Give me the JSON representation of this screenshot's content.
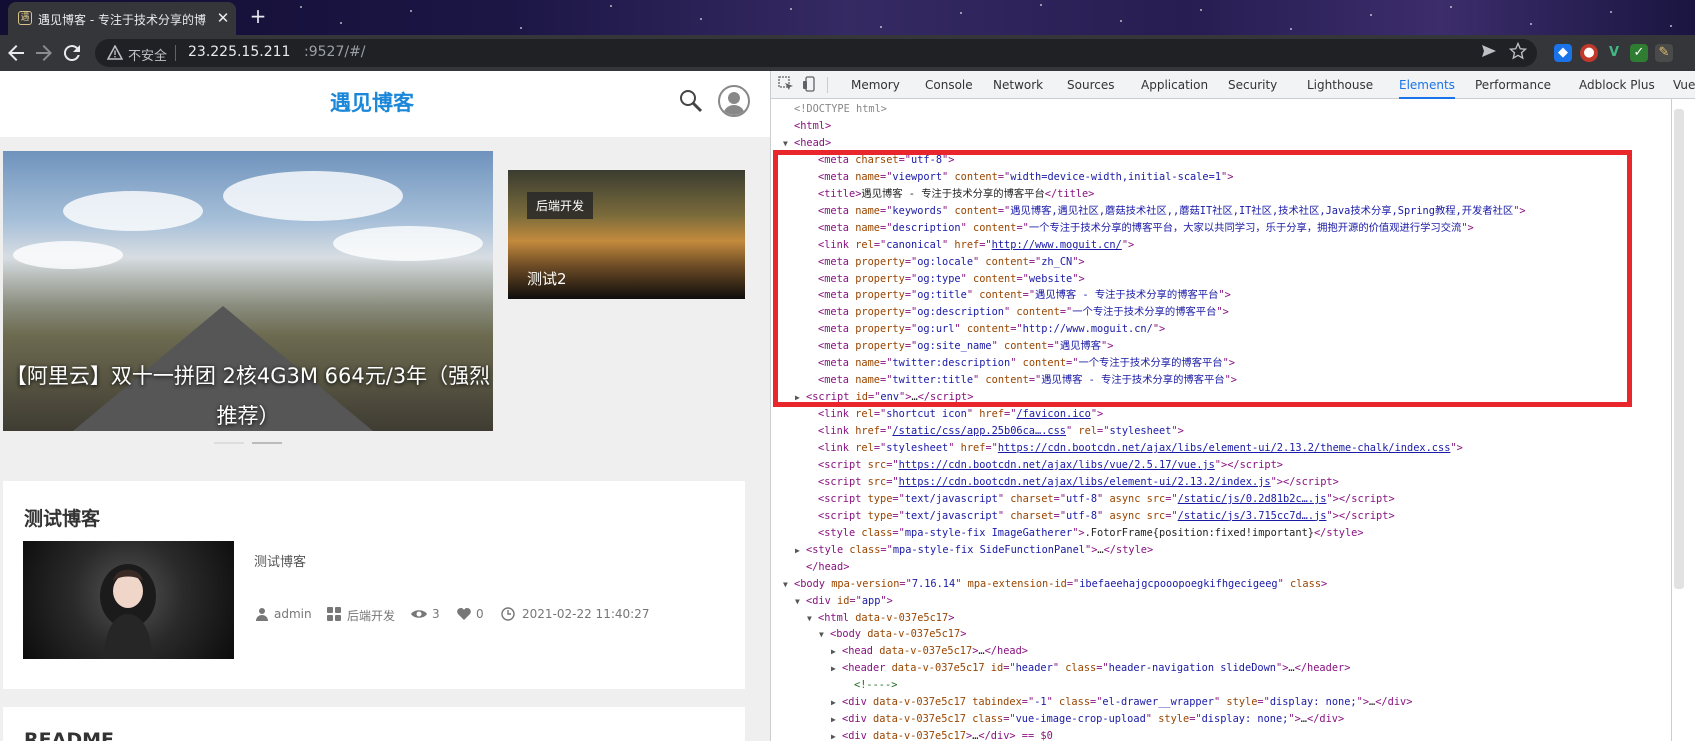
{
  "browser": {
    "tab_title": "遇见博客 - 专注于技术分享的博客平台",
    "tab_favicon": "遇",
    "close_glyph": "✕",
    "new_tab_glyph": "+",
    "security_label": "不安全",
    "url_host": "23.225.15.211",
    "url_path": ":9527/#/",
    "icons": {
      "back": "back-arrow-icon",
      "forward": "forward-arrow-icon",
      "reload": "reload-icon",
      "warning": "warning-icon",
      "send": "send-icon",
      "star": "bookmark-star-icon"
    },
    "extensions": [
      "ext-blue-icon",
      "ext-owl-icon",
      "ext-vue-icon",
      "ext-green-icon",
      "ext-puzzle-icon"
    ]
  },
  "site": {
    "name": "遇见博客",
    "hero_caption": "【阿里云】双十一拼团 2核4G3M 664元/3年（强烈推荐）",
    "side_tag": "后端开发",
    "side_title": "测试2",
    "card": {
      "title": "测试博客",
      "summary": "测试博客",
      "author": "admin",
      "category": "后端开发",
      "views": "3",
      "likes": "0",
      "date": "2021-02-22 11:40:27"
    },
    "card2_title": "README"
  },
  "devtools": {
    "tabs": [
      "Memory",
      "Console",
      "Network",
      "Sources",
      "Application",
      "Security",
      "Lighthouse",
      "Elements",
      "Performance",
      "Adblock Plus",
      "Vue"
    ],
    "active_tab": "Elements",
    "lines": [
      {
        "i": 0,
        "arrow": "",
        "html": "<span class=gy>&lt;!DOCTYPE html&gt;</span>"
      },
      {
        "i": 0,
        "arrow": "",
        "html": "<span class=tg>&lt;html&gt;</span>"
      },
      {
        "i": 0,
        "arrow": "▼",
        "html": "<span class=tg>&lt;head&gt;</span>"
      },
      {
        "i": 2,
        "arrow": "",
        "html": "<span class=tg>&lt;meta </span><span class=an>charset</span><span class=tg>=\"</span><span class=av>utf-8</span><span class=tg>\"&gt;</span>"
      },
      {
        "i": 2,
        "arrow": "",
        "html": "<span class=tg>&lt;meta </span><span class=an>name</span><span class=tg>=\"</span><span class=av>viewport</span><span class=tg>\" </span><span class=an>content</span><span class=tg>=\"</span><span class=av>width=device-width,initial-scale=1</span><span class=tg>\"&gt;</span>"
      },
      {
        "i": 2,
        "arrow": "",
        "html": "<span class=tg>&lt;title&gt;</span><span class=tx>遇见博客 - 专注于技术分享的博客平台</span><span class=tg>&lt;/title&gt;</span>"
      },
      {
        "i": 2,
        "arrow": "",
        "html": "<span class=tg>&lt;meta </span><span class=an>name</span><span class=tg>=\"</span><span class=av>keywords</span><span class=tg>\" </span><span class=an>content</span><span class=tg>=\"</span><span class=av>遇见博客,遇见社区,蘑菇技术社区,,蘑菇IT社区,IT社区,技术社区,Java技术分享,Spring教程,开发者社区</span><span class=tg>\"&gt;</span>"
      },
      {
        "i": 2,
        "arrow": "",
        "html": "<span class=tg>&lt;meta </span><span class=an>name</span><span class=tg>=\"</span><span class=av>description</span><span class=tg>\" </span><span class=an>content</span><span class=tg>=\"</span><span class=av>一个专注于技术分享的博客平台，大家以共同学习，乐于分享，拥抱开源的价值观进行学习交流</span><span class=tg>\"&gt;</span>"
      },
      {
        "i": 2,
        "arrow": "",
        "html": "<span class=tg>&lt;link </span><span class=an>rel</span><span class=tg>=\"</span><span class=av>canonical</span><span class=tg>\" </span><span class=an>href</span><span class=tg>=\"</span><span class=lk>http://www.moguit.cn/</span><span class=tg>\"&gt;</span>"
      },
      {
        "i": 2,
        "arrow": "",
        "html": "<span class=tg>&lt;meta </span><span class=an>property</span><span class=tg>=\"</span><span class=av>og:locale</span><span class=tg>\" </span><span class=an>content</span><span class=tg>=\"</span><span class=av>zh_CN</span><span class=tg>\"&gt;</span>"
      },
      {
        "i": 2,
        "arrow": "",
        "html": "<span class=tg>&lt;meta </span><span class=an>property</span><span class=tg>=\"</span><span class=av>og:type</span><span class=tg>\" </span><span class=an>content</span><span class=tg>=\"</span><span class=av>website</span><span class=tg>\"&gt;</span>"
      },
      {
        "i": 2,
        "arrow": "",
        "html": "<span class=tg>&lt;meta </span><span class=an>property</span><span class=tg>=\"</span><span class=av>og:title</span><span class=tg>\" </span><span class=an>content</span><span class=tg>=\"</span><span class=av>遇见博客 - 专注于技术分享的博客平台</span><span class=tg>\"&gt;</span>"
      },
      {
        "i": 2,
        "arrow": "",
        "html": "<span class=tg>&lt;meta </span><span class=an>property</span><span class=tg>=\"</span><span class=av>og:description</span><span class=tg>\" </span><span class=an>content</span><span class=tg>=\"</span><span class=av>一个专注于技术分享的博客平台</span><span class=tg>\"&gt;</span>"
      },
      {
        "i": 2,
        "arrow": "",
        "html": "<span class=tg>&lt;meta </span><span class=an>property</span><span class=tg>=\"</span><span class=av>og:url</span><span class=tg>\" </span><span class=an>content</span><span class=tg>=\"</span><span class=av>http://www.moguit.cn/</span><span class=tg>\"&gt;</span>"
      },
      {
        "i": 2,
        "arrow": "",
        "html": "<span class=tg>&lt;meta </span><span class=an>property</span><span class=tg>=\"</span><span class=av>og:site_name</span><span class=tg>\" </span><span class=an>content</span><span class=tg>=\"</span><span class=av>遇见博客</span><span class=tg>\"&gt;</span>"
      },
      {
        "i": 2,
        "arrow": "",
        "html": "<span class=tg>&lt;meta </span><span class=an>name</span><span class=tg>=\"</span><span class=av>twitter:description</span><span class=tg>\" </span><span class=an>content</span><span class=tg>=\"</span><span class=av>一个专注于技术分享的博客平台</span><span class=tg>\"&gt;</span>"
      },
      {
        "i": 2,
        "arrow": "",
        "html": "<span class=tg>&lt;meta </span><span class=an>name</span><span class=tg>=\"</span><span class=av>twitter:title</span><span class=tg>\" </span><span class=an>content</span><span class=tg>=\"</span><span class=av>遇见博客 - 专注于技术分享的博客平台</span><span class=tg>\"&gt;</span>"
      },
      {
        "i": 1,
        "arrow": "▶",
        "html": "<span class=tg>&lt;script </span><span class=an>id</span><span class=tg>=\"</span><span class=av>env</span><span class=tg>\"&gt;</span><span class=tx>…</span><span class=tg>&lt;/script&gt;</span>"
      },
      {
        "i": 2,
        "arrow": "",
        "html": "<span class=tg>&lt;link </span><span class=an>rel</span><span class=tg>=\"</span><span class=av>shortcut icon</span><span class=tg>\" </span><span class=an>href</span><span class=tg>=\"</span><span class=lk>/favicon.ico</span><span class=tg>\"&gt;</span>"
      },
      {
        "i": 2,
        "arrow": "",
        "html": "<span class=tg>&lt;link </span><span class=an>href</span><span class=tg>=\"</span><span class=lk>/static/css/app.25b06ca….css</span><span class=tg>\" </span><span class=an>rel</span><span class=tg>=\"</span><span class=av>stylesheet</span><span class=tg>\"&gt;</span>"
      },
      {
        "i": 2,
        "arrow": "",
        "html": "<span class=tg>&lt;link </span><span class=an>rel</span><span class=tg>=\"</span><span class=av>stylesheet</span><span class=tg>\" </span><span class=an>href</span><span class=tg>=\"</span><span class=lk>https://cdn.bootcdn.net/ajax/libs/element-ui/2.13.2/theme-chalk/index.css</span><span class=tg>\"&gt;</span>"
      },
      {
        "i": 2,
        "arrow": "",
        "html": "<span class=tg>&lt;script </span><span class=an>src</span><span class=tg>=\"</span><span class=lk>https://cdn.bootcdn.net/ajax/libs/vue/2.5.17/vue.js</span><span class=tg>\"&gt;&lt;/script&gt;</span>"
      },
      {
        "i": 2,
        "arrow": "",
        "html": "<span class=tg>&lt;script </span><span class=an>src</span><span class=tg>=\"</span><span class=lk>https://cdn.bootcdn.net/ajax/libs/element-ui/2.13.2/index.js</span><span class=tg>\"&gt;&lt;/script&gt;</span>"
      },
      {
        "i": 2,
        "arrow": "",
        "html": "<span class=tg>&lt;script </span><span class=an>type</span><span class=tg>=\"</span><span class=av>text/javascript</span><span class=tg>\" </span><span class=an>charset</span><span class=tg>=\"</span><span class=av>utf-8</span><span class=tg>\" </span><span class=an>async src</span><span class=tg>=\"</span><span class=lk>/static/js/0.2d81b2c….js</span><span class=tg>\"&gt;&lt;/script&gt;</span>"
      },
      {
        "i": 2,
        "arrow": "",
        "html": "<span class=tg>&lt;script </span><span class=an>type</span><span class=tg>=\"</span><span class=av>text/javascript</span><span class=tg>\" </span><span class=an>charset</span><span class=tg>=\"</span><span class=av>utf-8</span><span class=tg>\" </span><span class=an>async src</span><span class=tg>=\"</span><span class=lk>/static/js/3.715cc7d….js</span><span class=tg>\"&gt;&lt;/script&gt;</span>"
      },
      {
        "i": 2,
        "arrow": "",
        "html": "<span class=tg>&lt;style </span><span class=an>class</span><span class=tg>=\"</span><span class=av>mpa-style-fix ImageGatherer</span><span class=tg>\"&gt;</span><span class=tx>.FotorFrame{position:fixed!important}</span><span class=tg>&lt;/style&gt;</span>"
      },
      {
        "i": 1,
        "arrow": "▶",
        "html": "<span class=tg>&lt;style </span><span class=an>class</span><span class=tg>=\"</span><span class=av>mpa-style-fix SideFunctionPanel</span><span class=tg>\"&gt;</span><span class=tx>…</span><span class=tg>&lt;/style&gt;</span>"
      },
      {
        "i": 1,
        "arrow": "",
        "html": "<span class=tg>&lt;/head&gt;</span>"
      },
      {
        "i": 0,
        "arrow": "▼",
        "html": "<span class=tg>&lt;body </span><span class=an>mpa-version</span><span class=tg>=\"</span><span class=av>7.16.14</span><span class=tg>\" </span><span class=an>mpa-extension-id</span><span class=tg>=\"</span><span class=av>ibefaeehajgcpooopoegkifhgecigeeg</span><span class=tg>\" </span><span class=an>class</span><span class=tg>&gt;</span>"
      },
      {
        "i": 1,
        "arrow": "▼",
        "html": "<span class=tg>&lt;div </span><span class=an>id</span><span class=tg>=\"</span><span class=av>app</span><span class=tg>\"&gt;</span>"
      },
      {
        "i": 2,
        "arrow": "▼",
        "html": "<span class=tg>&lt;html </span><span class=an>data-v-037e5c17</span><span class=tg>&gt;</span>"
      },
      {
        "i": 3,
        "arrow": "▼",
        "html": "<span class=tg>&lt;body </span><span class=an>data-v-037e5c17</span><span class=tg>&gt;</span>"
      },
      {
        "i": 4,
        "arrow": "▶",
        "html": "<span class=tg>&lt;head </span><span class=an>data-v-037e5c17</span><span class=tg>&gt;</span><span class=tx>…</span><span class=tg>&lt;/head&gt;</span>"
      },
      {
        "i": 4,
        "arrow": "▶",
        "html": "<span class=tg>&lt;header </span><span class=an>data-v-037e5c17 id</span><span class=tg>=\"</span><span class=av>header</span><span class=tg>\" </span><span class=an>class</span><span class=tg>=\"</span><span class=av>header-navigation slideDown</span><span class=tg>\"&gt;</span><span class=tx>…</span><span class=tg>&lt;/header&gt;</span>"
      },
      {
        "i": 5,
        "arrow": "",
        "html": "<span class=cm>&lt;!----&gt;</span>"
      },
      {
        "i": 4,
        "arrow": "▶",
        "html": "<span class=tg>&lt;div </span><span class=an>data-v-037e5c17 tabindex</span><span class=tg>=\"</span><span class=av>-1</span><span class=tg>\" </span><span class=an>class</span><span class=tg>=\"</span><span class=av>el-drawer__wrapper</span><span class=tg>\" </span><span class=an>style</span><span class=tg>=\"</span><span class=av>display: none;</span><span class=tg>\"&gt;</span><span class=tx>…</span><span class=tg>&lt;/div&gt;</span>"
      },
      {
        "i": 4,
        "arrow": "▶",
        "html": "<span class=tg>&lt;div </span><span class=an>data-v-037e5c17 class</span><span class=tg>=\"</span><span class=av>vue-image-crop-upload</span><span class=tg>\" </span><span class=an>style</span><span class=tg>=\"</span><span class=av>display: none;</span><span class=tg>\"&gt;</span><span class=tx>…</span><span class=tg>&lt;/div&gt;</span>"
      },
      {
        "i": 4,
        "arrow": "▶",
        "html": "<span class=tg>&lt;div </span><span class=an>data-v-037e5c17</span><span class=tg>&gt;</span><span class=tx>…</span><span class=tg>&lt;/div&gt; == $0</span>"
      }
    ]
  }
}
